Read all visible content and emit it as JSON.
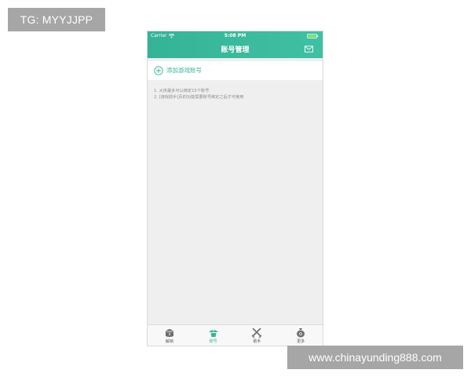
{
  "watermarks": {
    "top_left": "TG: MYYJJPP",
    "bottom_right": "www.chinayunding888.com"
  },
  "status_bar": {
    "carrier": "Carrier",
    "time": "5:08 PM"
  },
  "nav": {
    "title": "账号管理",
    "mail_icon": "mail-icon"
  },
  "add_account": {
    "label": "添加游戏账号",
    "icon": "plus-circle-icon"
  },
  "notes": [
    "1. 大侠最多可以绑定15个账号",
    "2. [游戏助手]页的功能需要账号绑定之后才可使用"
  ],
  "tabbar": {
    "active_index": 1,
    "items": [
      {
        "label": "解锁",
        "icon": "unlock-icon"
      },
      {
        "label": "账号",
        "icon": "account-hat-icon"
      },
      {
        "label": "助手",
        "icon": "crossed-swords-icon"
      },
      {
        "label": "更多",
        "icon": "money-bag-icon"
      }
    ]
  },
  "colors": {
    "accent": "#35b397",
    "background": "#efefef",
    "watermark": "#a6a6a6"
  }
}
